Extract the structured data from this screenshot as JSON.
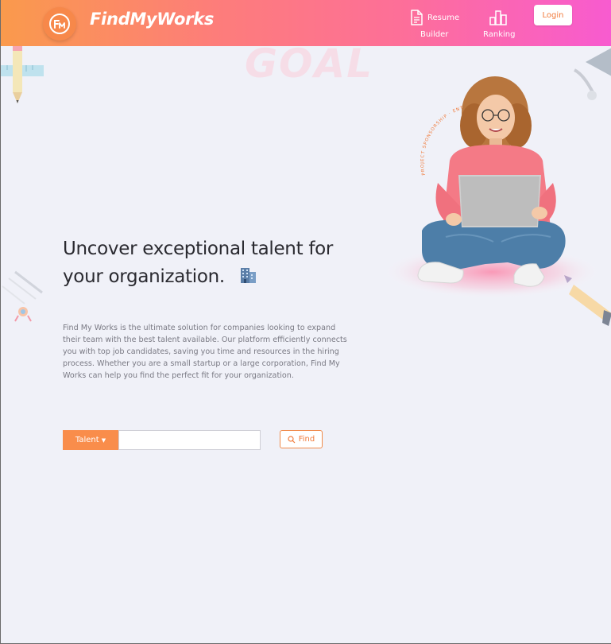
{
  "brand": {
    "name": "FindMyWorks",
    "logo_icon": "fmw-logo-icon"
  },
  "nav": {
    "resume_builder": {
      "line1": "Resume",
      "line2": "Builder",
      "icon": "document-icon"
    },
    "ranking": {
      "label": "Ranking",
      "icon": "bar-chart-icon"
    },
    "login_label": "Login"
  },
  "hero": {
    "background_word": "GOAL",
    "headline_line1": "Uncover exceptional talent for",
    "headline_line2": "your organization.",
    "headline_emoji": "building-icon",
    "description": "Find My Works is the ultimate solution for companies looking to expand their team with the best talent available. Our platform efficiently connects you with top job candidates, saving you time and resources in the hiring process. Whether you are a small startup or a large corporation, Find My Works can help you find the perfect fit for your organization.",
    "circular_text": "PROJECT SPONSORSHIP · ENTREPRENEUR"
  },
  "search": {
    "category_label": "Talent",
    "input_value": "",
    "input_placeholder": "",
    "find_label": "Find"
  },
  "colors": {
    "accent": "#f98d4b",
    "gradient_start": "#fa9a4c",
    "gradient_end": "#f85bd0",
    "background": "#f0f1f8"
  }
}
